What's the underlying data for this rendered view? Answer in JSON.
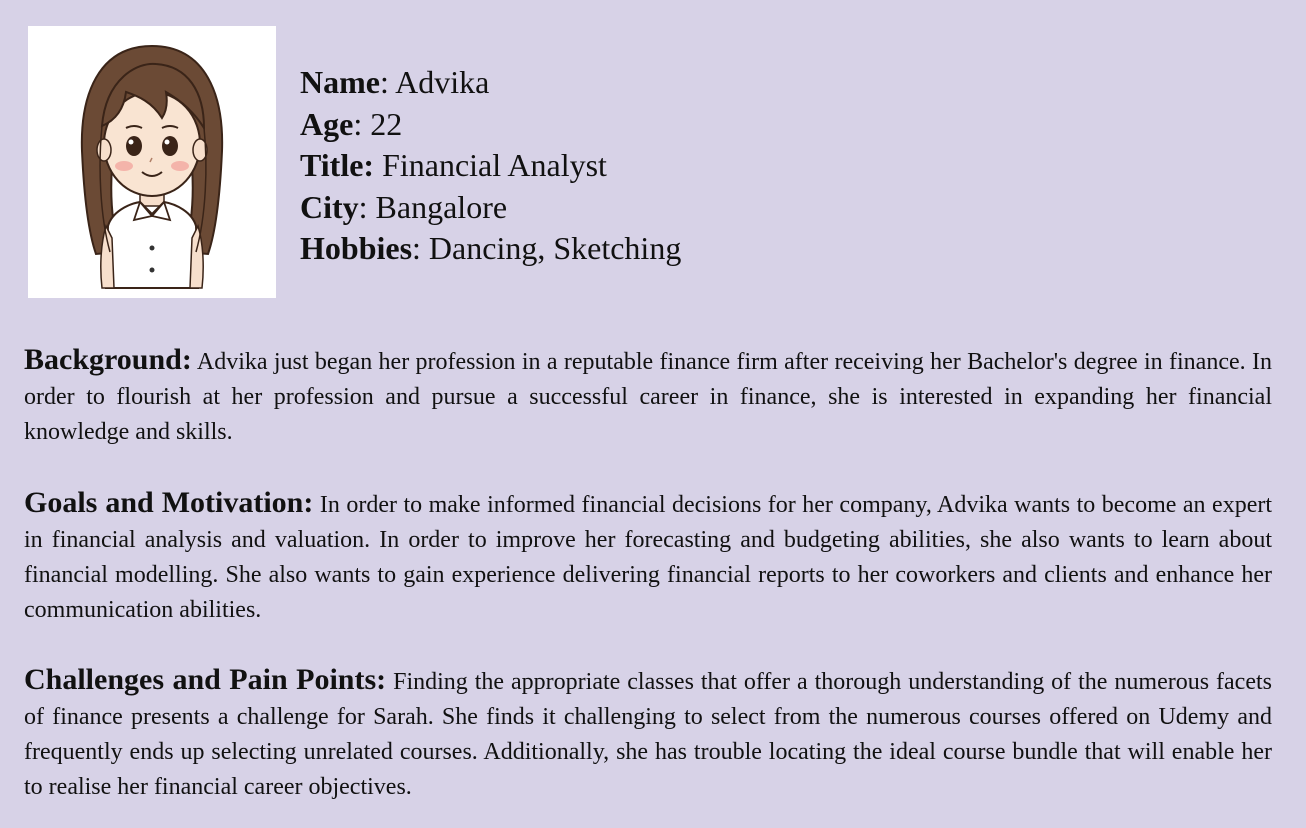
{
  "profile": {
    "name_label": "Name",
    "name_value": "Advika",
    "age_label": "Age",
    "age_value": "22",
    "title_label": "Title:",
    "title_value": "Financial Analyst",
    "city_label": "City",
    "city_value": "Bangalore",
    "hobbies_label": "Hobbies",
    "hobbies_value": "Dancing, Sketching"
  },
  "sections": {
    "background": {
      "heading": "Background:",
      "text": "Advika just began her profession in a reputable finance firm after receiving her Bachelor's degree in finance. In order to flourish at her profession and pursue a successful career in finance, she is interested in expanding her financial knowledge and skills."
    },
    "goals": {
      "heading": "Goals and Motivation:",
      "text": "In order to make informed financial decisions for her company, Advika wants to become an expert in financial analysis and valuation. In order to improve her forecasting and budgeting abilities, she also wants to learn about financial modelling. She also wants to gain experience delivering financial reports to her coworkers and clients and enhance her communication abilities."
    },
    "challenges": {
      "heading": "Challenges and Pain Points:",
      "text": "Finding the appropriate classes that offer a thorough understanding of the numerous facets of finance presents a challenge for Sarah. She finds it challenging to select from the numerous courses offered on Udemy and frequently ends up selecting unrelated courses. Additionally, she has trouble locating the ideal course bundle that will enable her to realise her financial career objectives."
    }
  },
  "colors": {
    "page_background": "#d7d2e7",
    "avatar_background": "#ffffff",
    "text": "#111111"
  }
}
